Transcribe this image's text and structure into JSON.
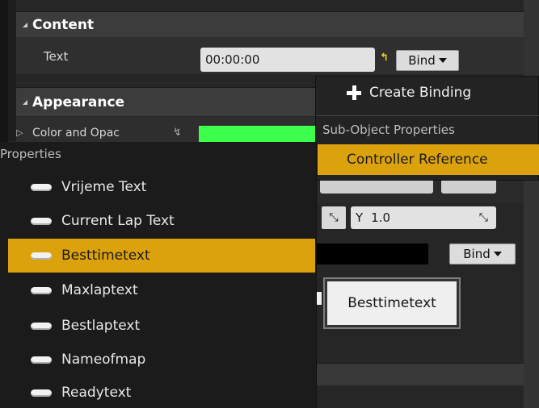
{
  "content": {
    "header": "Content",
    "text_label": "Text",
    "text_value": "00:00:00",
    "bind_label": "Bind"
  },
  "appearance": {
    "header": "Appearance",
    "color_label": "Color and Opac",
    "color_value": "#3bff4a"
  },
  "bind_menu": {
    "create_binding": "Create Binding",
    "sub_object_header": "Sub-Object Properties",
    "controller_reference": "Controller Reference"
  },
  "properties_menu": {
    "header": "Properties",
    "items": [
      {
        "label": "Vrijeme Text"
      },
      {
        "label": "Current Lap Text"
      },
      {
        "label": "Besttimetext"
      },
      {
        "label": "Maxlaptext"
      },
      {
        "label": "Bestlaptext"
      },
      {
        "label": "Nameofmap"
      },
      {
        "label": "Readytext"
      }
    ],
    "selected_index": 2
  },
  "transform": {
    "y_label": "Y",
    "y_value": "1.0"
  },
  "second_bind_label": "Bind",
  "preview_button_label": "Besttimetext",
  "colors": {
    "accent": "#dca20d",
    "selection_text": "#1a1a1a",
    "header_bg": "#3c3c3c",
    "popup_bg": "#232323"
  }
}
